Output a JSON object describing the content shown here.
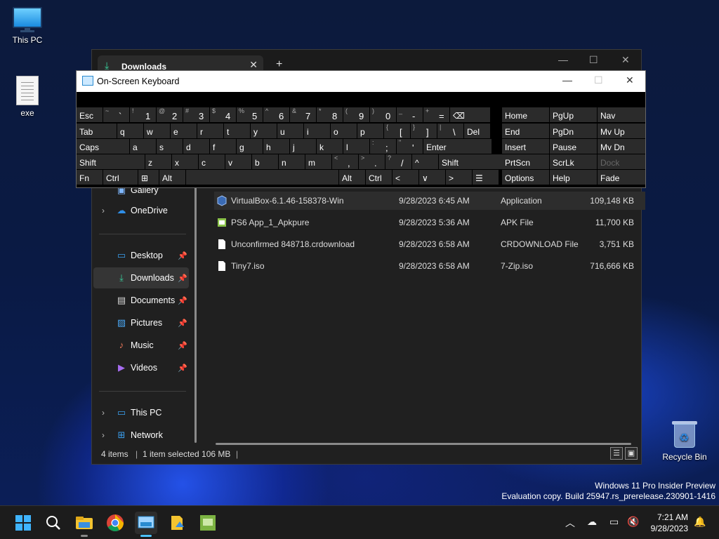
{
  "desktop": {
    "icons": [
      {
        "label": "This PC"
      },
      {
        "label": "exe"
      },
      {
        "label": "Recycle Bin"
      }
    ],
    "watermark": {
      "line1": "Windows 11 Pro Insider Preview",
      "line2": "Evaluation copy. Build 25947.rs_prerelease.230901-1416"
    }
  },
  "explorer": {
    "tab_label": "Downloads",
    "new_tab": "+",
    "controls": {
      "minimize": "—",
      "maximize": "☐",
      "close": "✕"
    },
    "sidebar": {
      "gallery": "Gallery",
      "onedrive": "OneDrive",
      "quick": [
        {
          "label": "Desktop"
        },
        {
          "label": "Downloads"
        },
        {
          "label": "Documents"
        },
        {
          "label": "Pictures"
        },
        {
          "label": "Music"
        },
        {
          "label": "Videos"
        }
      ],
      "thispc": "This PC",
      "network": "Network"
    },
    "files": [
      {
        "name": "VirtualBox-6.1.46-158378-Win",
        "date": "9/28/2023 6:45 AM",
        "type": "Application",
        "size": "109,148 KB"
      },
      {
        "name": "PS6 App_1_Apkpure",
        "date": "9/28/2023 5:36 AM",
        "type": "APK File",
        "size": "11,700 KB"
      },
      {
        "name": "Unconfirmed 848718.crdownload",
        "date": "9/28/2023 6:58 AM",
        "type": "CRDOWNLOAD File",
        "size": "3,751 KB"
      },
      {
        "name": "Tiny7.iso",
        "date": "9/28/2023 6:58 AM",
        "type": "7-Zip.iso",
        "size": "716,666 KB"
      }
    ],
    "status": {
      "count": "4 items",
      "selected": "1 item selected  106 MB"
    }
  },
  "osk": {
    "title": "On-Screen Keyboard",
    "controls": {
      "minimize": "—",
      "maximize": "☐",
      "close": "✕"
    },
    "row1": [
      {
        "m": "Esc"
      },
      {
        "s": "~",
        "p": "`"
      },
      {
        "s": "!",
        "p": "1"
      },
      {
        "s": "@",
        "p": "2"
      },
      {
        "s": "#",
        "p": "3"
      },
      {
        "s": "$",
        "p": "4"
      },
      {
        "s": "%",
        "p": "5"
      },
      {
        "s": "^",
        "p": "6"
      },
      {
        "s": "&",
        "p": "7"
      },
      {
        "s": "*",
        "p": "8"
      },
      {
        "s": "(",
        "p": "9"
      },
      {
        "s": ")",
        "p": "0"
      },
      {
        "s": "_",
        "p": "-"
      },
      {
        "s": "+",
        "p": "="
      },
      {
        "m": "⌫"
      }
    ],
    "row2": [
      {
        "m": "Tab"
      },
      {
        "m": "q"
      },
      {
        "m": "w"
      },
      {
        "m": "e"
      },
      {
        "m": "r"
      },
      {
        "m": "t"
      },
      {
        "m": "y"
      },
      {
        "m": "u"
      },
      {
        "m": "i"
      },
      {
        "m": "o"
      },
      {
        "m": "p"
      },
      {
        "s": "{",
        "p": "["
      },
      {
        "s": "}",
        "p": "]"
      },
      {
        "s": "|",
        "p": "\\"
      },
      {
        "m": "Del"
      }
    ],
    "row3": [
      {
        "m": "Caps"
      },
      {
        "m": "a"
      },
      {
        "m": "s"
      },
      {
        "m": "d"
      },
      {
        "m": "f"
      },
      {
        "m": "g"
      },
      {
        "m": "h"
      },
      {
        "m": "j"
      },
      {
        "m": "k"
      },
      {
        "m": "l"
      },
      {
        "s": ":",
        "p": ";"
      },
      {
        "s": "\"",
        "p": "'"
      },
      {
        "m": "Enter"
      }
    ],
    "row4": [
      {
        "m": "Shift"
      },
      {
        "m": "z"
      },
      {
        "m": "x"
      },
      {
        "m": "c"
      },
      {
        "m": "v"
      },
      {
        "m": "b"
      },
      {
        "m": "n"
      },
      {
        "m": "m"
      },
      {
        "s": "<",
        "p": ","
      },
      {
        "s": ">",
        "p": "."
      },
      {
        "s": "?",
        "p": "/"
      },
      {
        "m": "^"
      },
      {
        "m": "Shift"
      }
    ],
    "row5": [
      {
        "m": "Fn"
      },
      {
        "m": "Ctrl"
      },
      {
        "m": "⊞"
      },
      {
        "m": "Alt"
      },
      {
        "m": ""
      },
      {
        "m": "Alt"
      },
      {
        "m": "Ctrl"
      },
      {
        "m": "<"
      },
      {
        "m": "∨"
      },
      {
        "m": ">"
      },
      {
        "m": "☰"
      }
    ],
    "side": [
      [
        "Home",
        "PgUp",
        "Nav"
      ],
      [
        "End",
        "PgDn",
        "Mv Up"
      ],
      [
        "Insert",
        "Pause",
        "Mv Dn"
      ],
      [
        "PrtScn",
        "ScrLk",
        "Dock"
      ],
      [
        "Options",
        "Help",
        "Fade"
      ]
    ]
  },
  "taskbar": {
    "clock": {
      "time": "7:21 AM",
      "date": "9/28/2023"
    },
    "apps": [
      "start-icon",
      "search-icon",
      "file-explorer-icon",
      "chrome-icon",
      "osk-icon",
      "photos-icon",
      "apk-icon"
    ]
  }
}
